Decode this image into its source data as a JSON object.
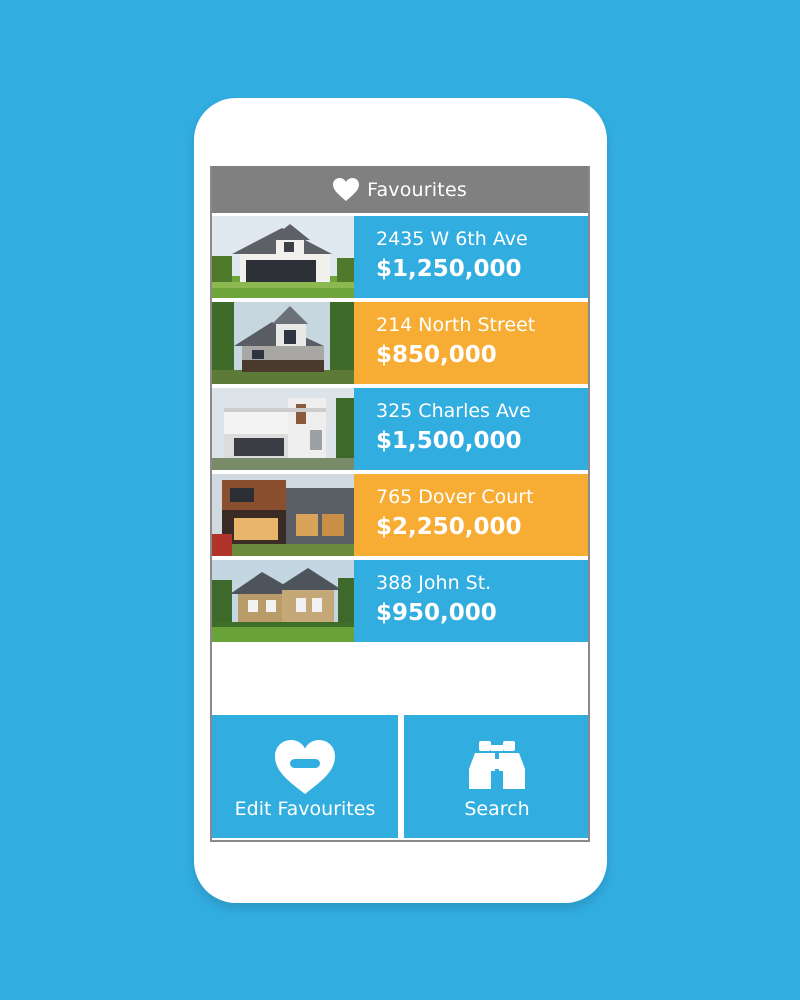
{
  "header": {
    "title": "Favourites",
    "icon": "heart-icon"
  },
  "colors": {
    "background": "#32ADE0",
    "header": "#808080",
    "blue": "#32ADE0",
    "orange": "#F7AC33"
  },
  "listings": [
    {
      "address": "2435 W 6th Ave",
      "price": "$1,250,000",
      "color": "blue"
    },
    {
      "address": "214 North Street",
      "price": "$850,000",
      "color": "orange"
    },
    {
      "address": "325 Charles Ave",
      "price": "$1,500,000",
      "color": "blue"
    },
    {
      "address": "765 Dover Court",
      "price": "$2,250,000",
      "color": "orange"
    },
    {
      "address": "388 John St.",
      "price": "$950,000",
      "color": "blue"
    }
  ],
  "actions": {
    "edit_label": "Edit Favourites",
    "edit_icon": "heart-minus-icon",
    "search_label": "Search",
    "search_icon": "binoculars-icon"
  }
}
